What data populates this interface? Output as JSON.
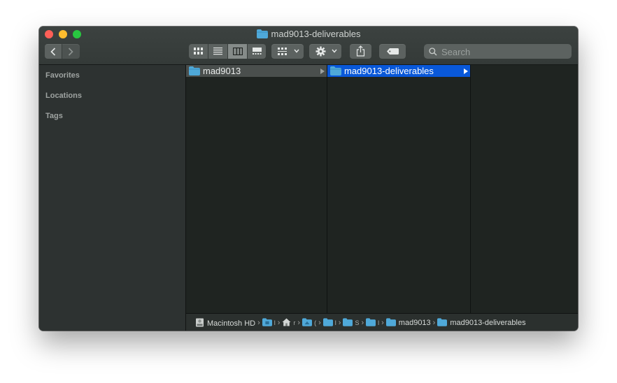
{
  "window": {
    "title": "mad9013-deliverables"
  },
  "toolbar": {
    "back_icon": "chevron-left-icon",
    "forward_icon": "chevron-right-icon",
    "view_modes": [
      "icon-view",
      "list-view",
      "column-view",
      "gallery-view"
    ],
    "selected_view": "column-view",
    "search_placeholder": "Search"
  },
  "sidebar": {
    "sections": [
      "Favorites",
      "Locations",
      "Tags"
    ]
  },
  "columns": [
    {
      "items": [
        {
          "label": "mad9013",
          "state": "inactive-selected"
        }
      ]
    },
    {
      "items": [
        {
          "label": "mad9013-deliverables",
          "state": "selected"
        }
      ]
    },
    {
      "items": []
    }
  ],
  "path_bar": {
    "items": [
      {
        "label": "Macintosh HD",
        "icon": "hard-drive-icon"
      },
      {
        "label": "l",
        "icon": "folder-icon"
      },
      {
        "label": "r",
        "icon": "home-icon"
      },
      {
        "label": "(",
        "icon": "folder-icon"
      },
      {
        "label": "l",
        "icon": "folder-icon"
      },
      {
        "label": "S",
        "icon": "folder-icon"
      },
      {
        "label": "l",
        "icon": "folder-icon"
      },
      {
        "label": "mad9013",
        "icon": "folder-icon"
      },
      {
        "label": "mad9013-deliverables",
        "icon": "folder-icon"
      }
    ],
    "separator": "›"
  },
  "colors": {
    "selection": "#0958d9",
    "folder": "#4fa9d9",
    "close": "#fe5f57",
    "minimize": "#febc2e",
    "zoom": "#28c840"
  }
}
